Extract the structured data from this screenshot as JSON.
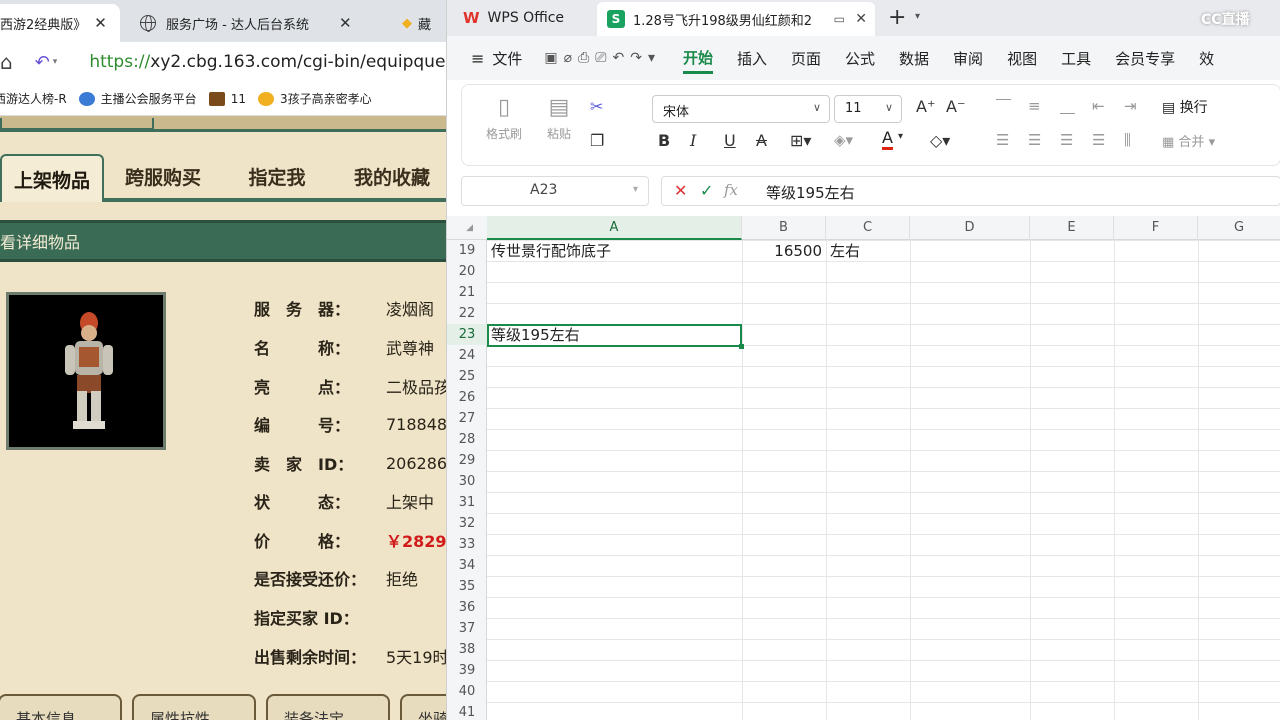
{
  "browser": {
    "tabs": [
      {
        "title": "西游2经典版》",
        "close": "✕",
        "active": true
      },
      {
        "title": "服务广场 - 达人后台系统",
        "close": "✕",
        "active": false
      },
      {
        "title": "藏",
        "active": false
      }
    ],
    "address": {
      "url_protocol": "https://",
      "url_rest": "xy2.cbg.163.com/cgi-bin/equipque"
    },
    "bookmarks": [
      {
        "label": "西游达人榜-R",
        "icon": "rank-icon",
        "color": "#e05a2b"
      },
      {
        "label": "主播公会服务平台",
        "icon": "guild-icon",
        "color": "#3a7bd5"
      },
      {
        "label": "11",
        "icon": "game-icon",
        "color": "#7a4a1a"
      },
      {
        "label": "3孩子高亲密孝心",
        "icon": "chick-icon",
        "color": "#f0b020"
      }
    ]
  },
  "game": {
    "nav_tabs": [
      "上架物品",
      "跨服购买",
      "指定我",
      "我的收藏"
    ],
    "section_title": "看详细物品",
    "info": [
      {
        "label": "服　务　器：",
        "value": "凌烟阁"
      },
      {
        "label": "名　　　称：",
        "value": "武尊神"
      },
      {
        "label": "亮　　　点：",
        "value": "二极品孩"
      },
      {
        "label": "编　　　号：",
        "value": "718848"
      },
      {
        "label": "卖　家　ID：",
        "value": "206286"
      },
      {
        "label": "状　　　态：",
        "value": "上架中"
      },
      {
        "label": "价　　　格：",
        "value": "￥2829",
        "price": true
      },
      {
        "label": "是否接受还价：",
        "value": "拒绝"
      },
      {
        "label": "指定买家 ID：",
        "value": ""
      },
      {
        "label": "出售剩余时间：",
        "value": "5天19时"
      }
    ],
    "bottom_buttons": [
      "基本信息",
      "属性抗性",
      "装备法宝",
      "坐骑"
    ]
  },
  "wps": {
    "app_name": "WPS Office",
    "doc_title": "1.28号飞升198级男仙红颜和2",
    "watermark": "CC直播",
    "menu": [
      "文件",
      "开始",
      "插入",
      "页面",
      "公式",
      "数据",
      "审阅",
      "视图",
      "工具",
      "会员专享",
      "效"
    ],
    "active_menu": "开始",
    "ribbon": {
      "format_painter": "格式刷",
      "paste": "粘贴",
      "font_name": "宋体",
      "font_size": "11",
      "wrap": "换行",
      "merge": "合并"
    },
    "name_box": "A23",
    "formula": "等级195左右",
    "columns": [
      "A",
      "B",
      "C",
      "D",
      "E",
      "F",
      "G"
    ],
    "rows": [
      "19",
      "20",
      "21",
      "22",
      "23",
      "24",
      "25",
      "26",
      "27",
      "28",
      "29",
      "30",
      "31",
      "32",
      "33",
      "34",
      "35",
      "36",
      "37",
      "38",
      "39",
      "40",
      "41"
    ],
    "cells": {
      "A19": "传世景行配饰底子",
      "B19": "16500",
      "C19": "左右",
      "A23": "等级195左右"
    },
    "selected_cell": "A23"
  }
}
